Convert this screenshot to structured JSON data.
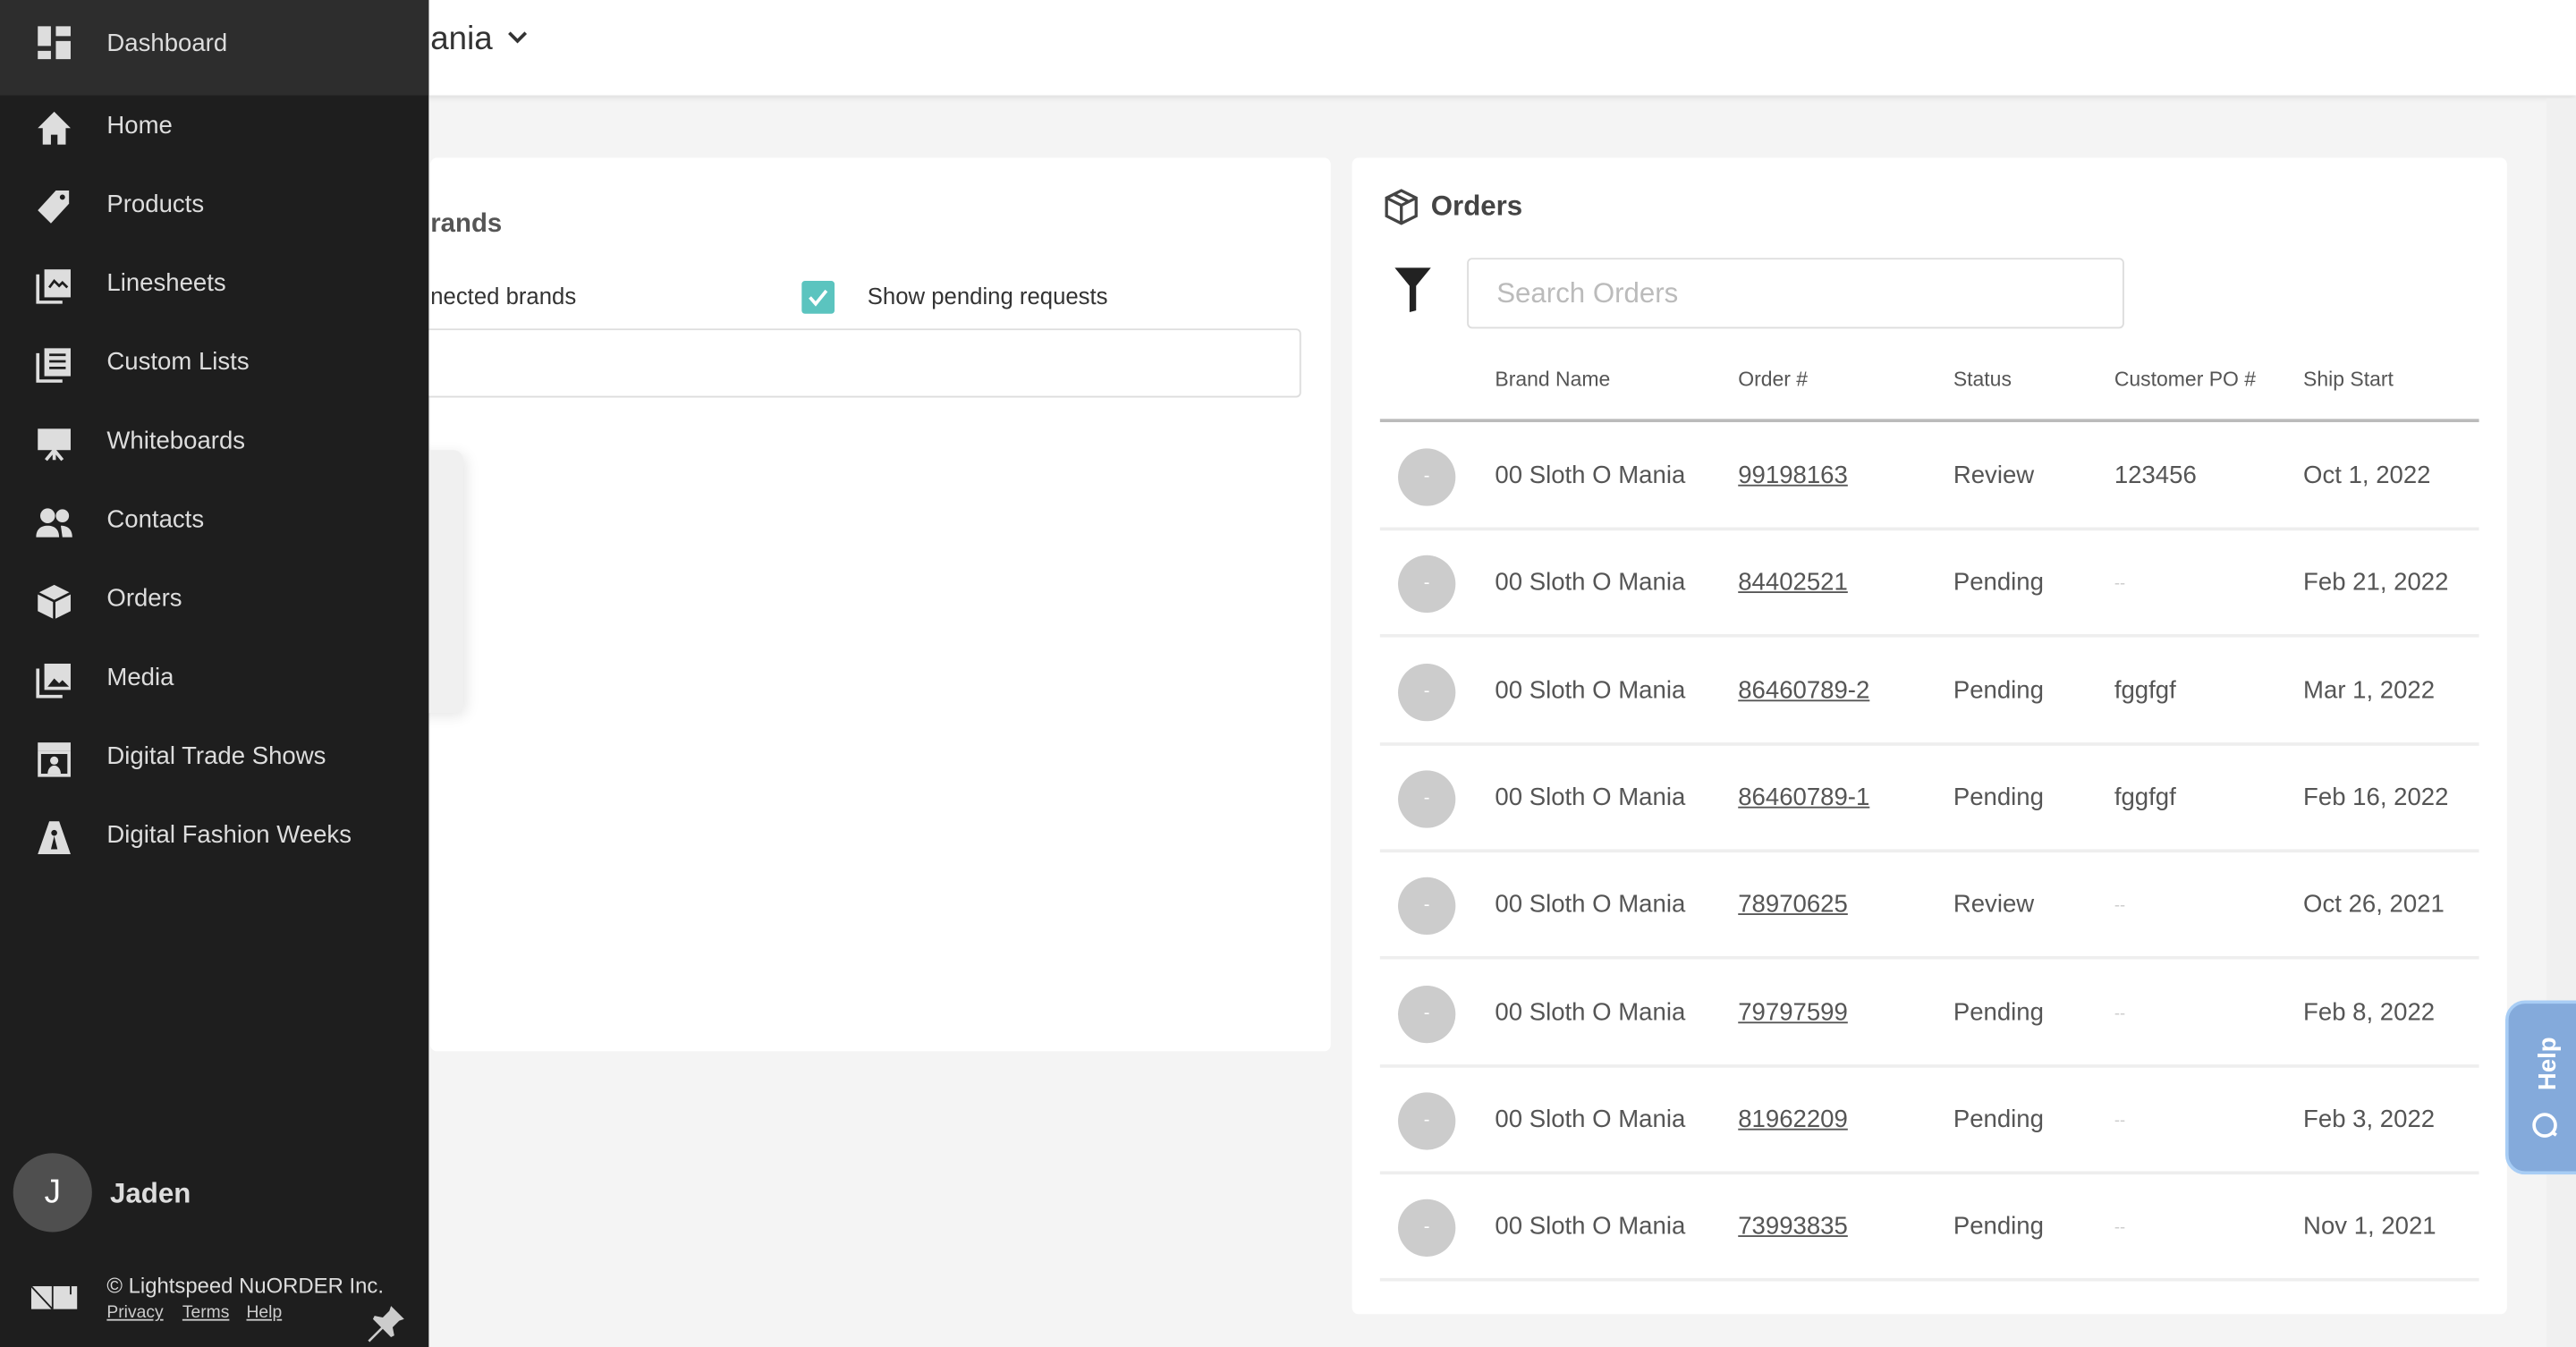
{
  "header": {
    "title": "ania"
  },
  "brands_card": {
    "title": "rands",
    "connected_label": "nected brands",
    "show_pending_label": "Show pending requests",
    "show_pending_checked": true,
    "accent": "#5bc4bf"
  },
  "orders": {
    "title": "Orders",
    "search_placeholder": "Search Orders",
    "columns": [
      "Brand Name",
      "Order #",
      "Status",
      "Customer PO #",
      "Ship Start"
    ],
    "rows": [
      {
        "avatar": "-",
        "brand": "00 Sloth O Mania",
        "order": "99198163",
        "status": "Review",
        "po": "123456",
        "ship": "Oct 1, 2022"
      },
      {
        "avatar": "-",
        "brand": "00 Sloth O Mania",
        "order": "84402521",
        "status": "Pending",
        "po": "--",
        "ship": "Feb 21, 2022"
      },
      {
        "avatar": "-",
        "brand": "00 Sloth O Mania",
        "order": "86460789-2",
        "status": "Pending",
        "po": "fggfgf",
        "ship": "Mar 1, 2022"
      },
      {
        "avatar": "-",
        "brand": "00 Sloth O Mania",
        "order": "86460789-1",
        "status": "Pending",
        "po": "fggfgf",
        "ship": "Feb 16, 2022"
      },
      {
        "avatar": "-",
        "brand": "00 Sloth O Mania",
        "order": "78970625",
        "status": "Review",
        "po": "--",
        "ship": "Oct 26, 2021"
      },
      {
        "avatar": "-",
        "brand": "00 Sloth O Mania",
        "order": "79797599",
        "status": "Pending",
        "po": "--",
        "ship": "Feb 8, 2022"
      },
      {
        "avatar": "-",
        "brand": "00 Sloth O Mania",
        "order": "81962209",
        "status": "Pending",
        "po": "--",
        "ship": "Feb 3, 2022"
      },
      {
        "avatar": "-",
        "brand": "00 Sloth O Mania",
        "order": "73993835",
        "status": "Pending",
        "po": "--",
        "ship": "Nov 1, 2021"
      }
    ]
  },
  "sidebar": {
    "header": {
      "label": "Dashboard",
      "icon": "dashboard-icon"
    },
    "items": [
      {
        "label": "Home",
        "icon": "home-icon"
      },
      {
        "label": "Products",
        "icon": "tag-icon"
      },
      {
        "label": "Linesheets",
        "icon": "linesheets-icon"
      },
      {
        "label": "Custom Lists",
        "icon": "list-icon"
      },
      {
        "label": "Whiteboards",
        "icon": "whiteboard-icon"
      },
      {
        "label": "Contacts",
        "icon": "contacts-icon"
      },
      {
        "label": "Orders",
        "icon": "box-icon"
      },
      {
        "label": "Media",
        "icon": "image-icon"
      },
      {
        "label": "Digital Trade Shows",
        "icon": "storefront-icon"
      },
      {
        "label": "Digital Fashion Weeks",
        "icon": "runway-icon"
      }
    ],
    "user": {
      "initial": "J",
      "name": "Jaden"
    },
    "footer": {
      "copyright": "© Lightspeed NuORDER Inc.",
      "links": [
        "Privacy",
        "Terms",
        "Help"
      ]
    }
  },
  "help_tab": {
    "label": "Help",
    "color": "#84aadb"
  }
}
